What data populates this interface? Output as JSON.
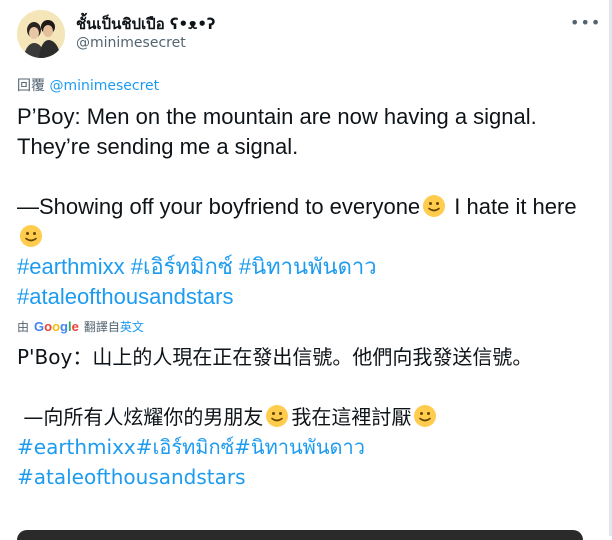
{
  "tweet": {
    "author_name": "ชั้นเป็นชิปเปือ ʕ•ᴥ•ʔ",
    "author_handle": "@minimesecret",
    "reply_prefix": "回覆 ",
    "reply_mention": "@minimesecret",
    "text_line1": "P’Boy: Men on the mountain are now having a signal. They’re sending me a signal.",
    "text_line2a": "—Showing off your boyfriend to everyone",
    "text_line2b": " I hate it here",
    "hashtag_1": "#earthmixx",
    "hashtag_2": "#เอิร์ทมิกซ์",
    "hashtag_3": "#นิทานพันดาว",
    "hashtag_4": "#ataleofthousandstars"
  },
  "translation": {
    "by_label": "由",
    "provider": "Google",
    "action_label": "翻譯自",
    "source_language": "英文",
    "line1": "P'Boy：山上的人現在正在發出信號。他們向我發送信號。",
    "line2a": "—向所有人炫耀你的男朋友",
    "line2b": "我在這裡討厭",
    "hashtags_line": "#earthmixx#เอิร์ทมิกซ์#นิทานพันดาว",
    "hashtag_last": "#ataleofthousandstars"
  },
  "icons": {
    "more": "more-horizontal-icon",
    "emoji": "slightly-smiling-face-emoji"
  },
  "colors": {
    "link": "#1d9bf0",
    "secondary_text": "#536471",
    "primary_text": "#0f1419"
  }
}
